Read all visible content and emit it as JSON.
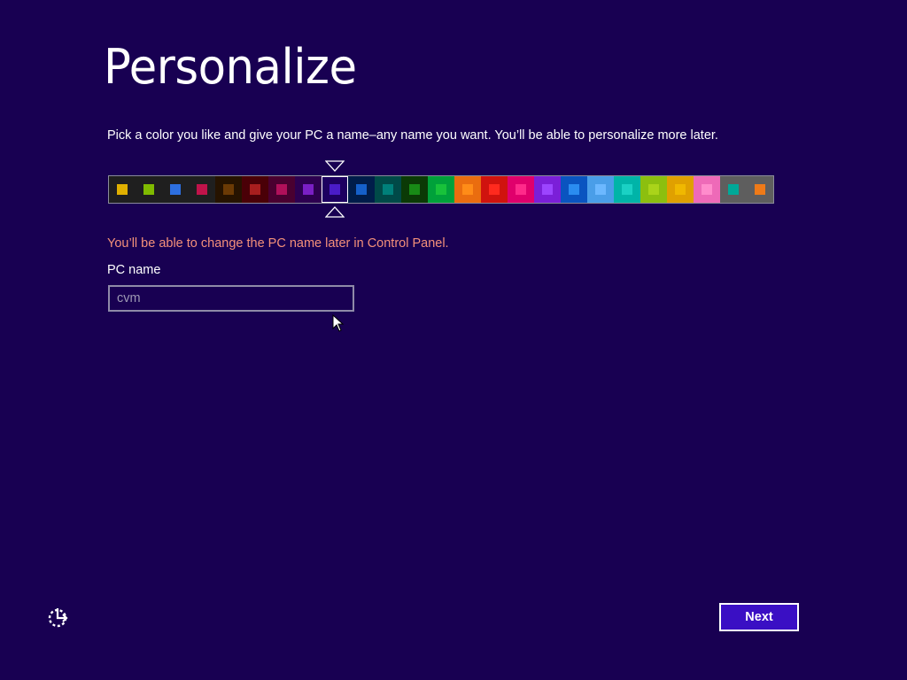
{
  "page": {
    "title": "Personalize",
    "subtitle": "Pick a color you like and give your PC a name–any name you want. You’ll be able to personalize more later.",
    "warning": "You’ll be able to change the PC name later in Control Panel.",
    "pc_name_label": "PC name"
  },
  "pc_name_input": {
    "value": "",
    "placeholder": "cvm"
  },
  "buttons": {
    "next": "Next"
  },
  "icons": {
    "ease_of_access": "ease-of-access-icon",
    "cursor": "mouse-pointer-icon",
    "marker_down": "selection-marker-down-icon",
    "marker_up": "selection-marker-up-icon"
  },
  "swatches": {
    "selected_index": 8,
    "items": [
      {
        "bg": "#1f1f1f",
        "chip": "#e0b000"
      },
      {
        "bg": "#1f1f1f",
        "chip": "#7fba00"
      },
      {
        "bg": "#1f1f1f",
        "chip": "#2d6fe0"
      },
      {
        "bg": "#1f1f1f",
        "chip": "#c0134a"
      },
      {
        "bg": "#261300",
        "chip": "#6b3a05"
      },
      {
        "bg": "#4a0007",
        "chip": "#a81e1e"
      },
      {
        "bg": "#4a0030",
        "chip": "#b0105a"
      },
      {
        "bg": "#2d0050",
        "chip": "#7a1fc4"
      },
      {
        "bg": "#1d0060",
        "chip": "#4a1cc8"
      },
      {
        "bg": "#001d4a",
        "chip": "#1560c9"
      },
      {
        "bg": "#004a48",
        "chip": "#00807a"
      },
      {
        "bg": "#0b3a06",
        "chip": "#188a16"
      },
      {
        "bg": "#00a13a",
        "chip": "#18c23a"
      },
      {
        "bg": "#ea6d0f",
        "chip": "#ff8c18"
      },
      {
        "bg": "#d0130e",
        "chip": "#ff2a1e"
      },
      {
        "bg": "#e0006c",
        "chip": "#ff2a8a"
      },
      {
        "bg": "#7b1fd8",
        "chip": "#9c45ff"
      },
      {
        "bg": "#0a54c0",
        "chip": "#2a8cf0"
      },
      {
        "bg": "#4a9ee8",
        "chip": "#6cb8ff"
      },
      {
        "bg": "#00b4a8",
        "chip": "#1ad1c4"
      },
      {
        "bg": "#8cbf0f",
        "chip": "#aad41a"
      },
      {
        "bg": "#e0a000",
        "chip": "#f0b800"
      },
      {
        "bg": "#ee6ab8",
        "chip": "#ff8ccc"
      },
      {
        "bg": "#5e5e5e",
        "chip": "#00a898"
      },
      {
        "bg": "#5e5e5e",
        "chip": "#ee7a18"
      }
    ]
  }
}
